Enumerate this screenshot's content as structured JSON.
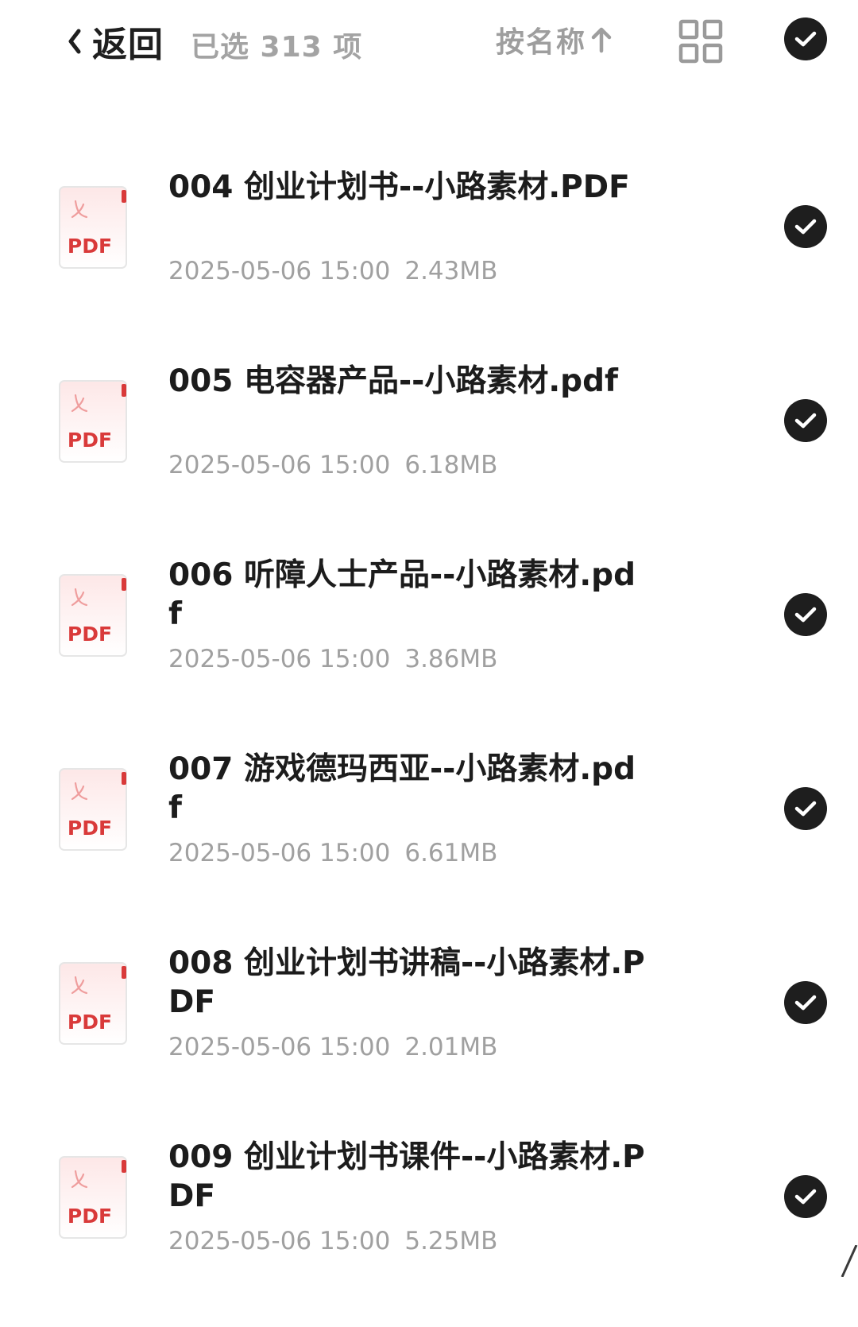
{
  "header": {
    "back_label": "返回",
    "selected_text": "已选 313 项",
    "sort_label": "按名称"
  },
  "icons": {
    "back": "chevron-left-icon",
    "sort": "arrow-up-icon",
    "view": "grid-view-icon",
    "check": "check-circle-icon",
    "file": "pdf-file-icon"
  },
  "colors": {
    "check_bg": "#1e1e1e",
    "pdf_red": "#d93a3a",
    "meta_gray": "#a0a0a0"
  },
  "files": [
    {
      "name": "004 创业计划书--小路素材.PDF",
      "date": "2025-05-06 15:00",
      "size": "2.43MB",
      "type_label": "PDF"
    },
    {
      "name": "005 电容器产品--小路素材.pdf",
      "date": "2025-05-06 15:00",
      "size": "6.18MB",
      "type_label": "PDF"
    },
    {
      "name": "006 听障人士产品--小路素材.pdf",
      "date": "2025-05-06 15:00",
      "size": "3.86MB",
      "type_label": "PDF"
    },
    {
      "name": "007 游戏德玛西亚--小路素材.pdf",
      "date": "2025-05-06 15:00",
      "size": "6.61MB",
      "type_label": "PDF"
    },
    {
      "name": "008 创业计划书讲稿--小路素材.PDF",
      "date": "2025-05-06 15:00",
      "size": "2.01MB",
      "type_label": "PDF"
    },
    {
      "name": "009 创业计划书课件--小路素材.PDF",
      "date": "2025-05-06 15:00",
      "size": "5.25MB",
      "type_label": "PDF"
    }
  ]
}
